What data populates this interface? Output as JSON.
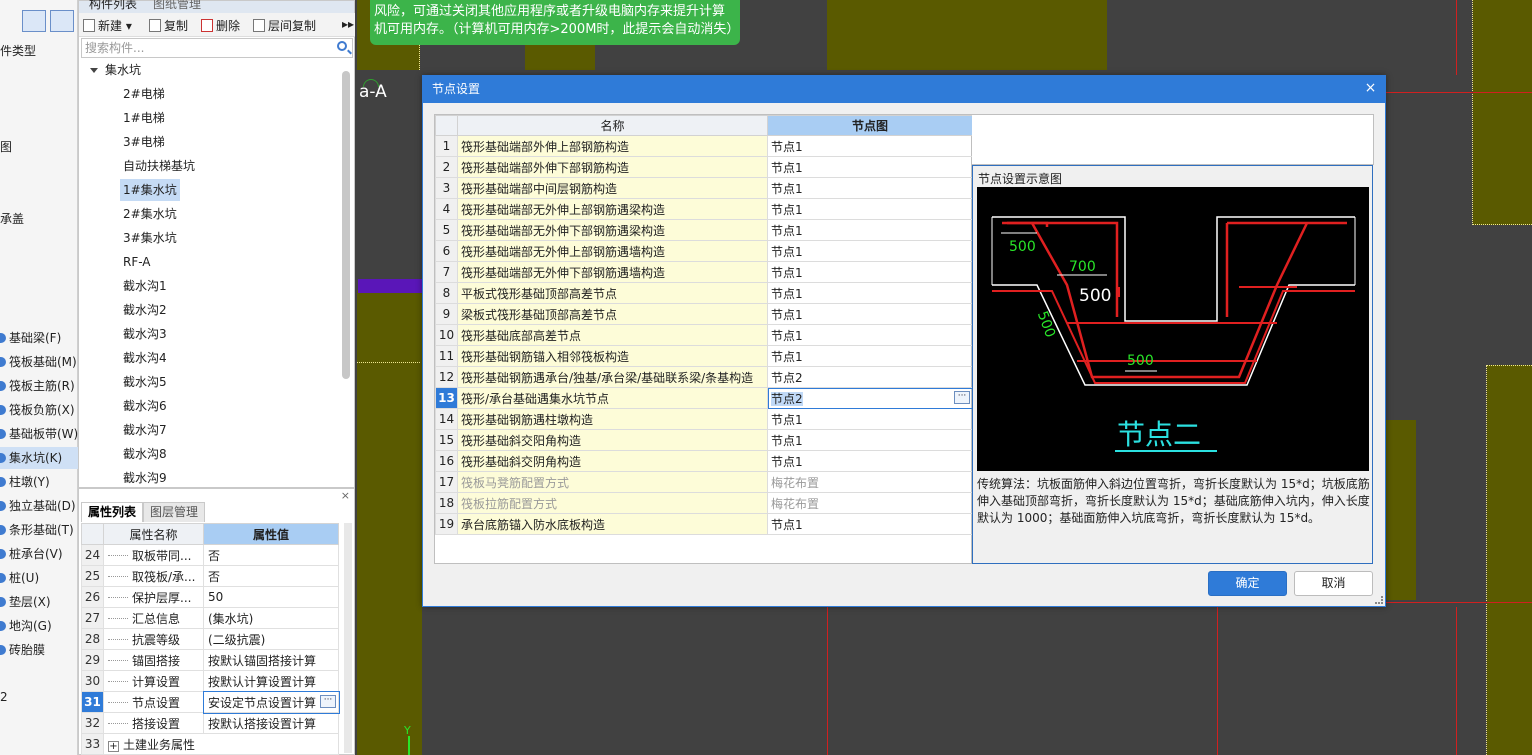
{
  "left_categories": {
    "fragments": [
      "件类型",
      "图",
      "承盖"
    ],
    "items": [
      {
        "label": "基础梁(F)",
        "selected": false
      },
      {
        "label": "筏板基础(M)",
        "selected": false
      },
      {
        "label": "筏板主筋(R)",
        "selected": false
      },
      {
        "label": "筏板负筋(X)",
        "selected": false
      },
      {
        "label": "基础板带(W)",
        "selected": false
      },
      {
        "label": "集水坑(K)",
        "selected": true
      },
      {
        "label": "柱墩(Y)",
        "selected": false
      },
      {
        "label": "独立基础(D)",
        "selected": false
      },
      {
        "label": "条形基础(T)",
        "selected": false
      },
      {
        "label": "桩承台(V)",
        "selected": false
      },
      {
        "label": "桩(U)",
        "selected": false
      },
      {
        "label": "垫层(X)",
        "selected": false
      },
      {
        "label": "地沟(G)",
        "selected": false
      },
      {
        "label": "砖胎膜",
        "selected": false
      }
    ],
    "last_fragment": "2"
  },
  "component_panel": {
    "tabs": [
      "构件列表",
      "图纸管理"
    ],
    "toolbar": {
      "new": "新建",
      "copy": "复制",
      "delete": "删除",
      "floor_copy": "层间复制"
    },
    "search_placeholder": "搜索构件...",
    "tree_root": "集水坑",
    "tree_items": [
      "2#电梯",
      "1#电梯",
      "3#电梯",
      "自动扶梯基坑",
      "1#集水坑",
      "2#集水坑",
      "3#集水坑",
      "RF-A",
      "截水沟1",
      "截水沟2",
      "截水沟3",
      "截水沟4",
      "截水沟5",
      "截水沟6",
      "截水沟7",
      "截水沟8",
      "截水沟9"
    ],
    "selected_item": "1#集水坑"
  },
  "property_panel": {
    "close": "×",
    "tabs": [
      "属性列表",
      "图层管理"
    ],
    "headers": {
      "name": "属性名称",
      "value": "属性值"
    },
    "rows": [
      {
        "num": "24",
        "name": "取板带同...",
        "value": "否"
      },
      {
        "num": "25",
        "name": "取筏板/承...",
        "value": "否"
      },
      {
        "num": "26",
        "name": "保护层厚...",
        "value": "50"
      },
      {
        "num": "27",
        "name": "汇总信息",
        "value": "(集水坑)"
      },
      {
        "num": "28",
        "name": "抗震等级",
        "value": "(二级抗震)"
      },
      {
        "num": "29",
        "name": "锚固搭接",
        "value": "按默认锚固搭接计算"
      },
      {
        "num": "30",
        "name": "计算设置",
        "value": "按默认计算设置计算"
      },
      {
        "num": "31",
        "name": "节点设置",
        "value": "安设定节点设置计算",
        "selected": true
      },
      {
        "num": "32",
        "name": "搭接设置",
        "value": "按默认搭接设置计算"
      },
      {
        "num": "33",
        "name": "土建业务属性",
        "value": "",
        "group": true
      }
    ]
  },
  "canvas": {
    "axis_label": "a-A",
    "y_axis_label": "Y",
    "toast_text": "风险，可通过关闭其他应用程序或者升级电脑内存来提升计算机可用内存。（计算机可用内存>200M时，此提示会自动消失）"
  },
  "dialog": {
    "title": "节点设置",
    "close": "×",
    "table_headers": {
      "name": "名称",
      "node": "节点图"
    },
    "rows": [
      {
        "num": "1",
        "name": "筏形基础端部外伸上部钢筋构造",
        "node": "节点1"
      },
      {
        "num": "2",
        "name": "筏形基础端部外伸下部钢筋构造",
        "node": "节点1"
      },
      {
        "num": "3",
        "name": "筏形基础端部中间层钢筋构造",
        "node": "节点1"
      },
      {
        "num": "4",
        "name": "筏形基础端部无外伸上部钢筋遇梁构造",
        "node": "节点1"
      },
      {
        "num": "5",
        "name": "筏形基础端部无外伸下部钢筋遇梁构造",
        "node": "节点1"
      },
      {
        "num": "6",
        "name": "筏形基础端部无外伸上部钢筋遇墙构造",
        "node": "节点1"
      },
      {
        "num": "7",
        "name": "筏形基础端部无外伸下部钢筋遇墙构造",
        "node": "节点1"
      },
      {
        "num": "8",
        "name": "平板式筏形基础顶部高差节点",
        "node": "节点1"
      },
      {
        "num": "9",
        "name": "梁板式筏形基础顶部高差节点",
        "node": "节点1"
      },
      {
        "num": "10",
        "name": "筏形基础底部高差节点",
        "node": "节点1"
      },
      {
        "num": "11",
        "name": "筏形基础钢筋锚入相邻筏板构造",
        "node": "节点1"
      },
      {
        "num": "12",
        "name": "筏形基础钢筋遇承台/独基/承台梁/基础联系梁/条基构造",
        "node": "节点2"
      },
      {
        "num": "13",
        "name": "筏形/承台基础遇集水坑节点",
        "node": "节点2",
        "selected": true
      },
      {
        "num": "14",
        "name": "筏形基础钢筋遇柱墩构造",
        "node": "节点1"
      },
      {
        "num": "15",
        "name": "筏形基础斜交阳角构造",
        "node": "节点1"
      },
      {
        "num": "16",
        "name": "筏形基础斜交阴角构造",
        "node": "节点1"
      },
      {
        "num": "17",
        "name": "筏板马凳筋配置方式",
        "node": "梅花布置",
        "disabled": true
      },
      {
        "num": "18",
        "name": "筏板拉筋配置方式",
        "node": "梅花布置",
        "disabled": true
      },
      {
        "num": "19",
        "name": "承台底筋锚入防水底板构造",
        "node": "节点1"
      }
    ],
    "diagram": {
      "title": "节点设置示意图",
      "image_label": "节点二",
      "dims": [
        "500",
        "700",
        "500",
        "500",
        "500"
      ],
      "description": "传统算法：坑板面筋伸入斜边位置弯折，弯折长度默认为 15*d；坑板底筋伸入基础顶部弯折，弯折长度默认为 15*d；基础底筋伸入坑内，伸入长度默认为 1000；基础面筋伸入坑底弯折，弯折长度默认为 15*d。"
    },
    "ok": "确定",
    "cancel": "取消"
  },
  "colors": {
    "accent": "#2f7bd8",
    "olive_fill": "#5a5a00",
    "toast_green": "#3cb44a",
    "purple_bar": "#5a16b8",
    "rebar_red": "#e02020",
    "dim_green": "#29e529",
    "label_cyan": "#2be0e0"
  },
  "icons": [
    "list-view-icon",
    "grid-view-icon",
    "new-icon",
    "copy-icon",
    "delete-icon",
    "floor-copy-icon",
    "search-icon",
    "expand-caret-icon",
    "close-icon",
    "ellipsis-icon",
    "resize-grip-icon"
  ]
}
